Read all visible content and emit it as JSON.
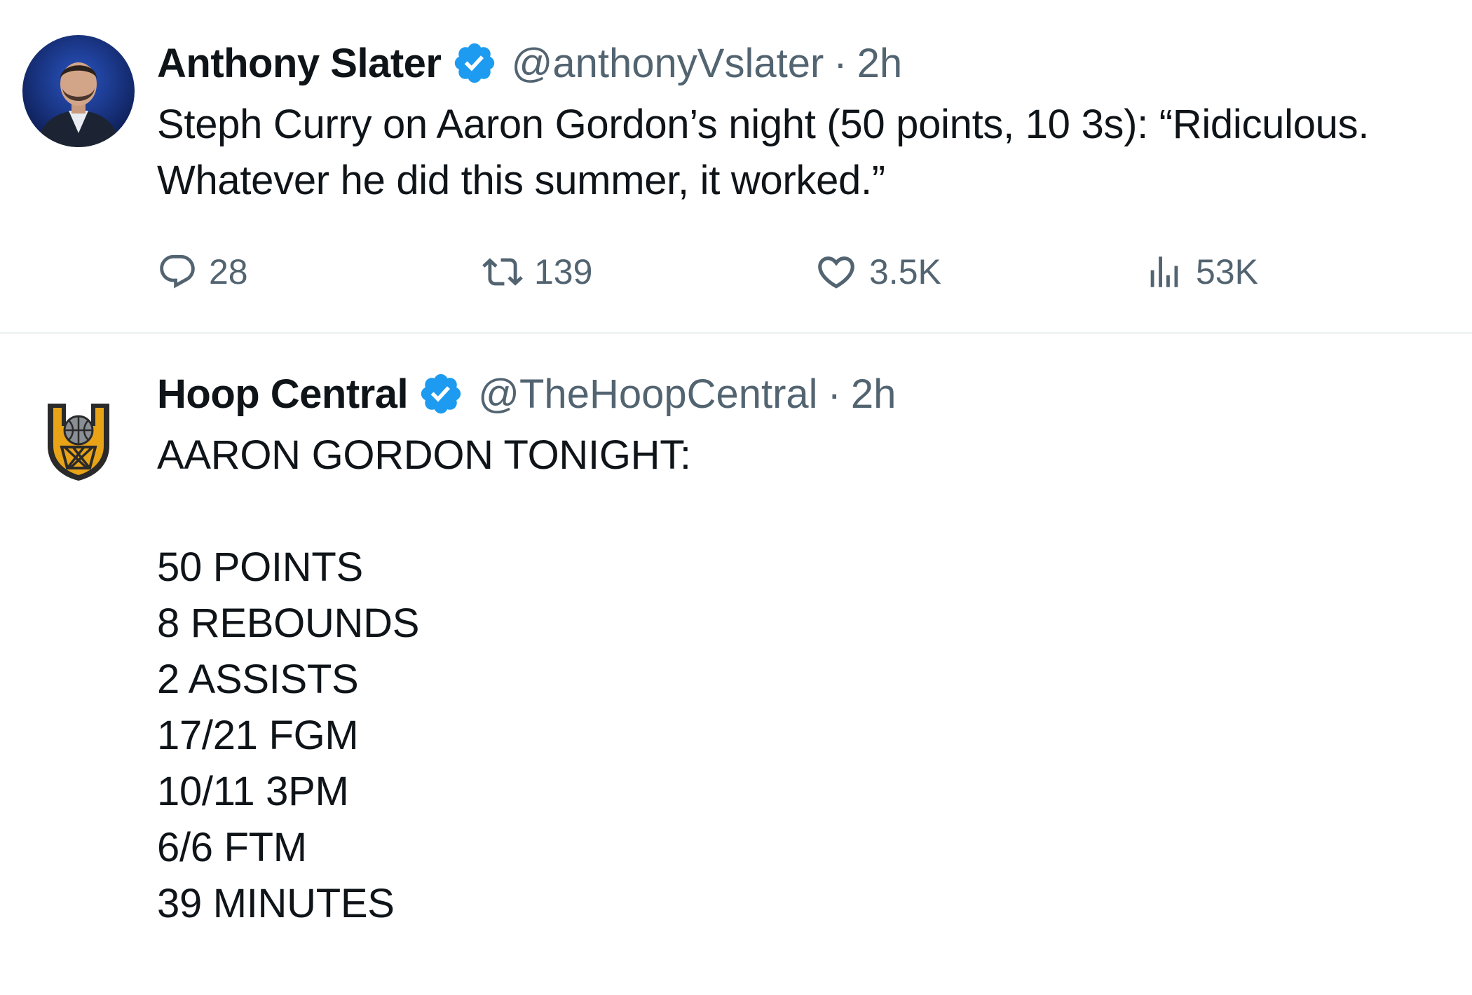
{
  "tweets": [
    {
      "author_name": "Anthony Slater",
      "handle": "@anthonyVslater",
      "separator": "·",
      "time": "2h",
      "text": "Steph Curry on Aaron Gordon’s night (50 points, 10 3s): “Ridiculous. Whatever he did this summer, it worked.”",
      "avatar_icon": "person-photo-avatar",
      "verified_icon": "verified-badge-icon",
      "actions": {
        "replies": "28",
        "retweets": "139",
        "likes": "3.5K",
        "views": "53K"
      }
    },
    {
      "author_name": "Hoop Central",
      "handle": "@TheHoopCentral",
      "separator": "·",
      "time": "2h",
      "text": "AARON GORDON TONIGHT:\n\n50 POINTS\n8 REBOUNDS\n2 ASSISTS\n17/21 FGM\n10/11 3PM\n6/6 FTM\n39 MINUTES",
      "avatar_icon": "hoop-central-logo",
      "verified_icon": "verified-badge-icon"
    }
  ],
  "colors": {
    "text_primary": "#0f1419",
    "text_secondary": "#536471",
    "verified_blue": "#1d9bf0",
    "divider": "#eff3f4",
    "logo_gold": "#e8a317",
    "logo_dark": "#2a2a2a"
  }
}
